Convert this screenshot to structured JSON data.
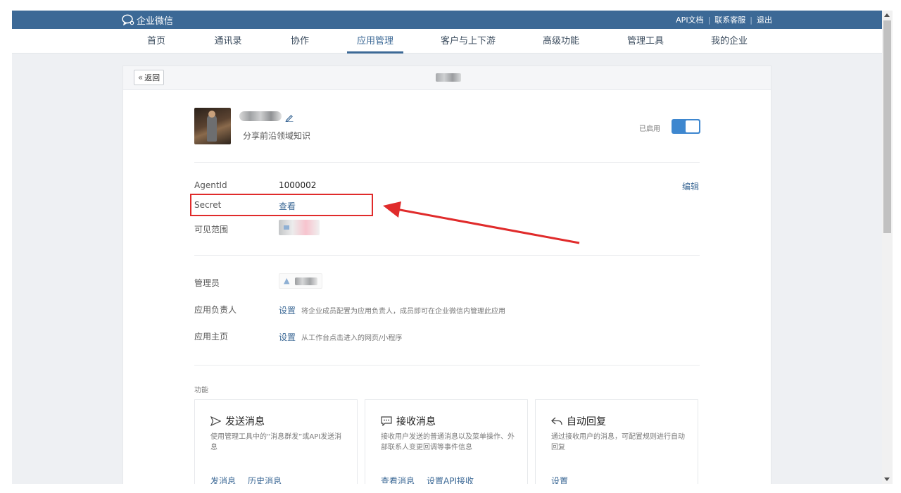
{
  "topbar": {
    "logo_text": "企业微信",
    "links": [
      "API文档",
      "联系客服",
      "退出"
    ],
    "separator": "|"
  },
  "nav": {
    "items": [
      "首页",
      "通讯录",
      "协作",
      "应用管理",
      "客户与上下游",
      "高级功能",
      "管理工具",
      "我的企业"
    ],
    "active": "应用管理"
  },
  "page": {
    "back_label": "返回",
    "title": ""
  },
  "app": {
    "name": "",
    "description": "分享前沿领域知识",
    "status_label": "已启用",
    "enabled": true
  },
  "details": {
    "edit_label": "编辑",
    "agentid_label": "AgentId",
    "agentid_value": "1000002",
    "secret_label": "Secret",
    "secret_action": "查看",
    "visible_label": "可见范围",
    "visible_value": ""
  },
  "admin": {
    "admins_label": "管理员",
    "admin_value": "",
    "owner_label": "应用负责人",
    "owner_action": "设置",
    "owner_hint": "将企业成员配置为应用负责人，成员即可在企业微信内管理此应用",
    "homepage_label": "应用主页",
    "homepage_action": "设置",
    "homepage_hint": "从工作台点击进入的网页/小程序"
  },
  "features": {
    "section_label": "功能",
    "cards": [
      {
        "icon": "send-icon",
        "title": "发送消息",
        "desc": "使用管理工具中的“消息群发”或API发送消息",
        "actions": [
          "发消息",
          "历史消息"
        ]
      },
      {
        "icon": "chat-icon",
        "title": "接收消息",
        "desc": "接收用户发送的普通消息以及菜单操作、外部联系人变更回调等事件信息",
        "actions": [
          "查看消息",
          "设置API接收"
        ]
      },
      {
        "icon": "reply-icon",
        "title": "自动回复",
        "desc": "通过接收用户的消息，可配置规则进行自动回复",
        "actions": [
          "设置"
        ]
      }
    ]
  },
  "colors": {
    "brand": "#3c6996",
    "toggle": "#3e87cf",
    "annotation": "#e02b2b"
  }
}
